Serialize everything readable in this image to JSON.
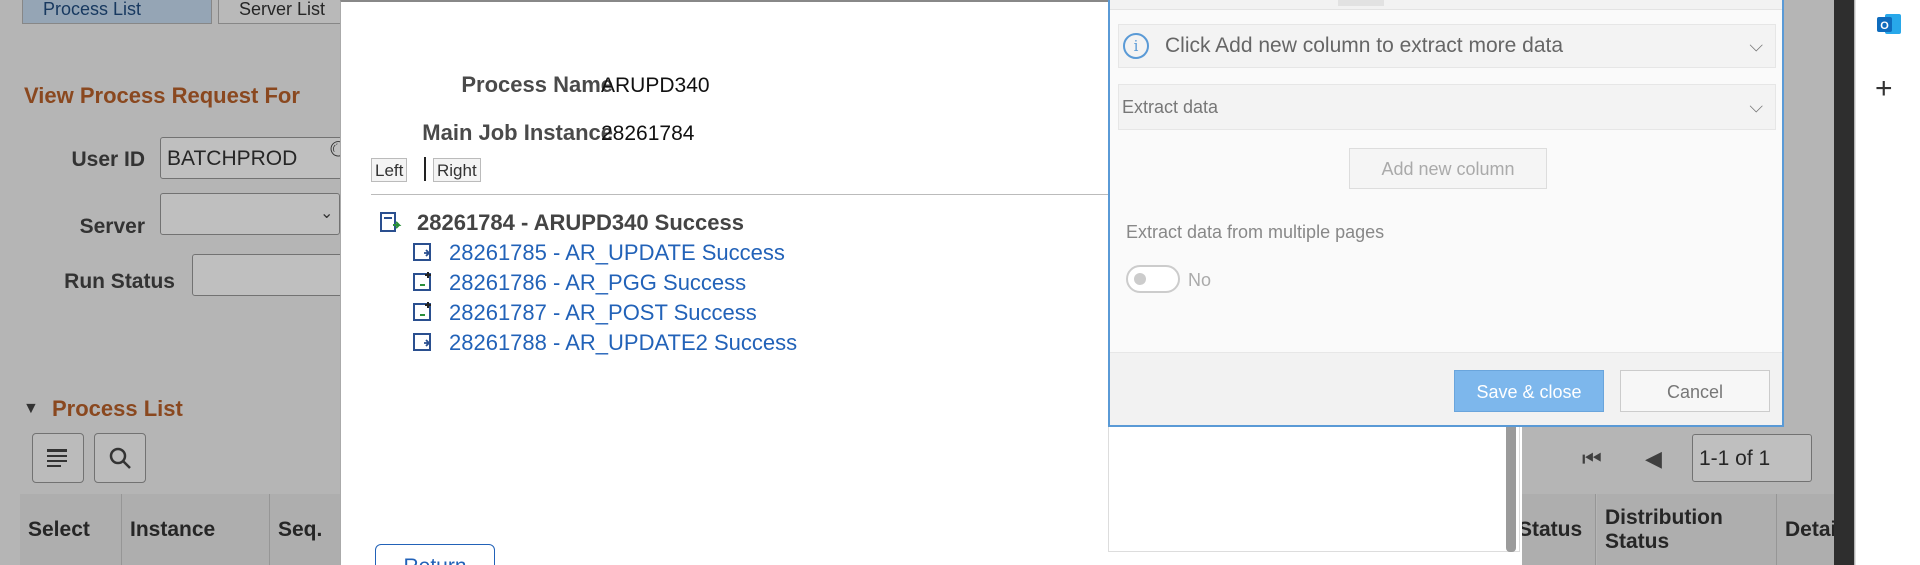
{
  "background": {
    "tabs": [
      "Process List",
      "Server List"
    ],
    "heading": "View Process Request For",
    "user_id_label": "User ID",
    "user_id_value": "BATCHPROD",
    "server_label": "Server",
    "run_status_label": "Run Status",
    "process_list_heading": "Process List",
    "pager": "1-1 of 1",
    "columns": [
      "Select",
      "Instance",
      "Seq.",
      "Status",
      "Distribution Status",
      "Details"
    ]
  },
  "modal": {
    "process_name_label": "Process Name",
    "process_name_value": "ARUPD340",
    "main_job_label": "Main Job Instance",
    "main_job_value": "28261784",
    "left_label": "Left",
    "right_label": "Right",
    "tree": {
      "root": "28261784 - ARUPD340 Success",
      "children": [
        "28261785 - AR_UPDATE Success",
        "28261786 - AR_PGG Success",
        "28261787 - AR_POST Success",
        "28261788 - AR_UPDATE2 Success"
      ]
    },
    "return_label": "Return"
  },
  "dialog": {
    "info_text": "Click Add new column to extract more data",
    "extract_section": "Extract data",
    "add_column_label": "Add new column",
    "multi_page_label": "Extract data from multiple pages",
    "toggle_state": "No",
    "save_label": "Save & close",
    "cancel_label": "Cancel"
  },
  "colors": {
    "accent": "#5a9ad6",
    "link": "#2262b8",
    "heading_orange": "#b8602a",
    "outlook_blue": "#0f6cbd"
  }
}
